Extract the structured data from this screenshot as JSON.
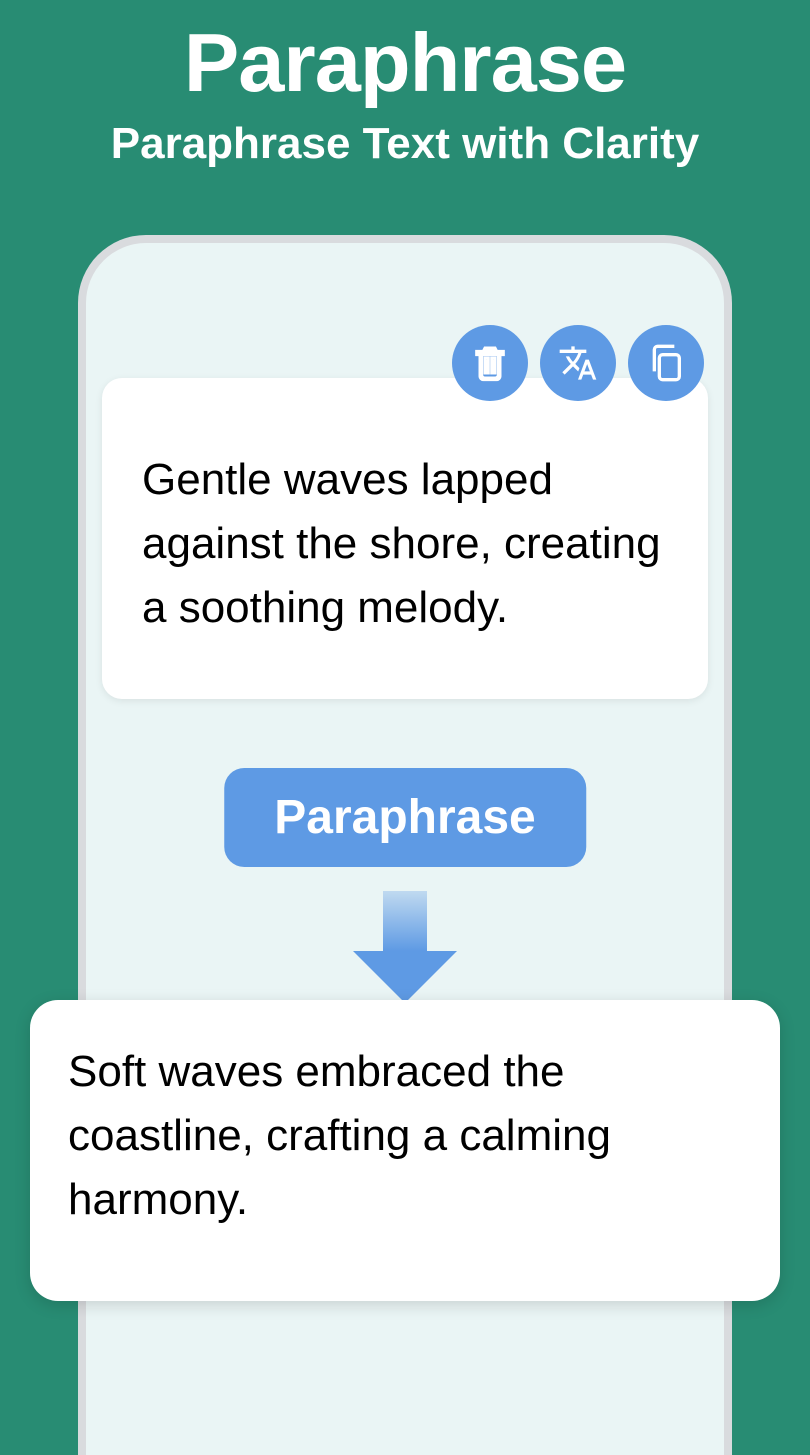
{
  "header": {
    "title": "Paraphrase",
    "subtitle": "Paraphrase Text with Clarity"
  },
  "input": {
    "text": "Gentle waves lapped against the shore, creating a soothing melody."
  },
  "button": {
    "label": "Paraphrase"
  },
  "output": {
    "text": "Soft waves embraced the coastline, crafting a calming harmony."
  }
}
